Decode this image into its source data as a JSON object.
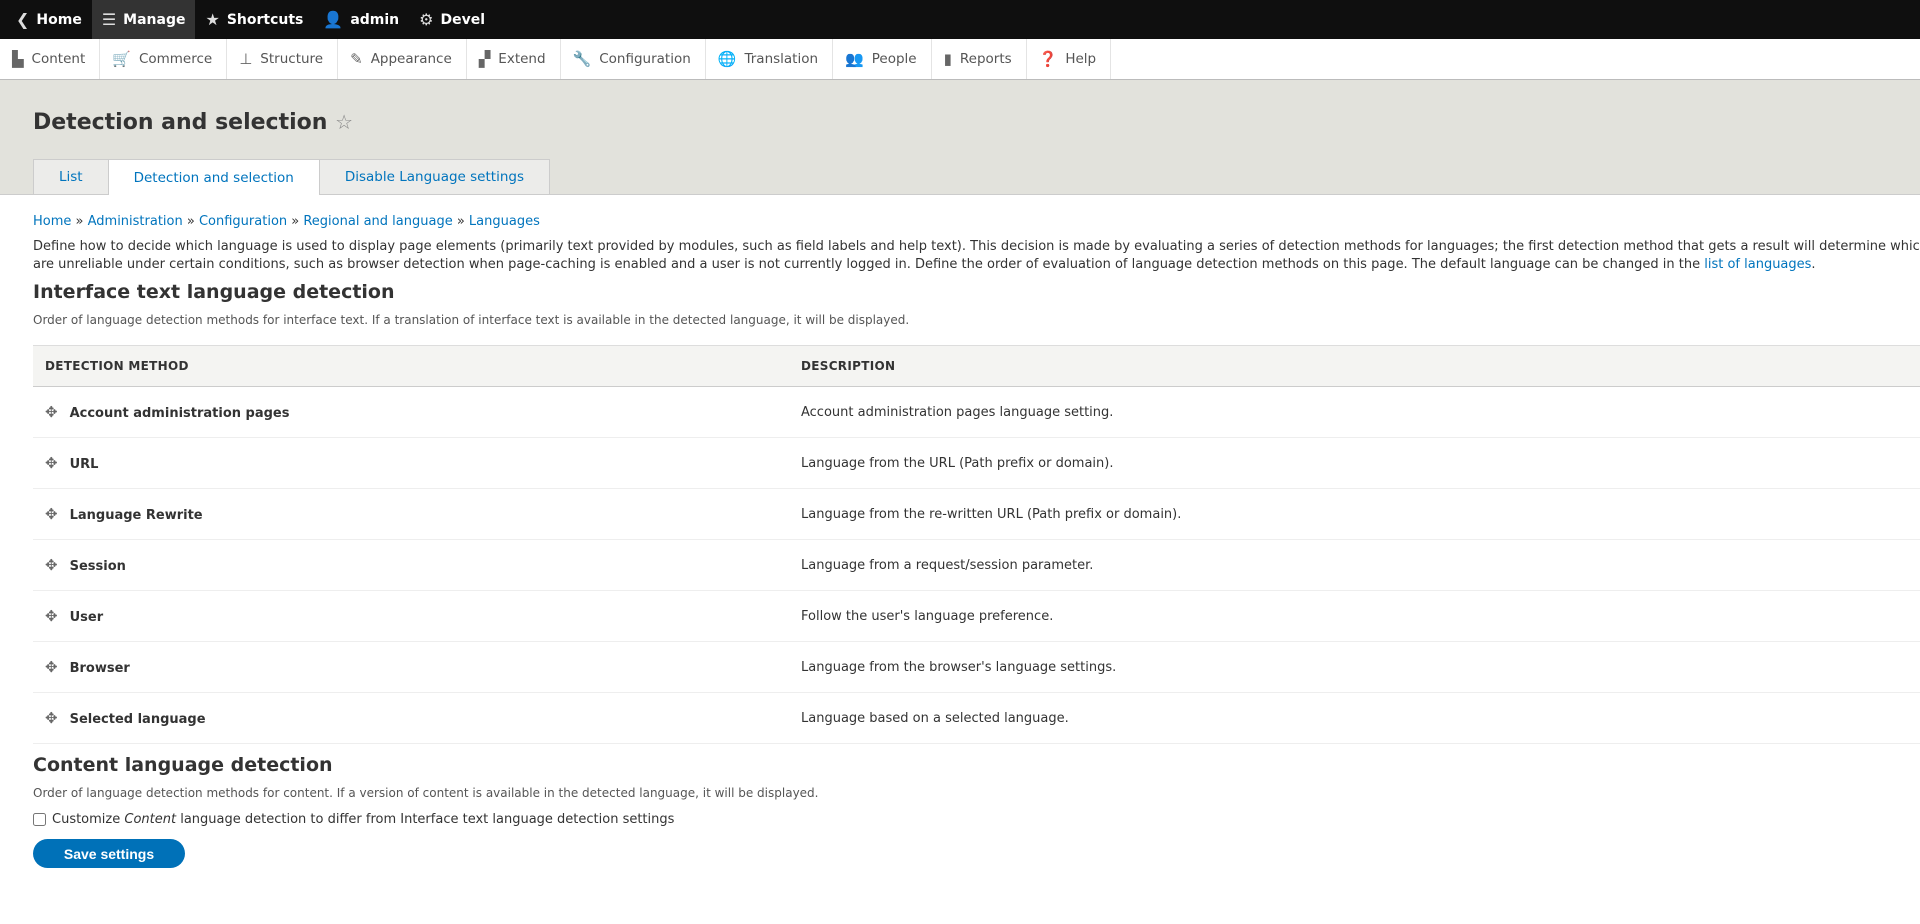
{
  "toolbar": {
    "items": [
      {
        "label": "Home",
        "icon": "chevron-left-circle-icon"
      },
      {
        "label": "Manage",
        "icon": "menu-icon"
      },
      {
        "label": "Shortcuts",
        "icon": "star-icon"
      },
      {
        "label": "admin",
        "icon": "user-icon"
      },
      {
        "label": "Devel",
        "icon": "gear-icon"
      }
    ]
  },
  "tray": {
    "items": [
      {
        "label": "Content",
        "icon": "file-icon"
      },
      {
        "label": "Commerce",
        "icon": "cart-icon"
      },
      {
        "label": "Structure",
        "icon": "sitemap-icon"
      },
      {
        "label": "Appearance",
        "icon": "brush-icon"
      },
      {
        "label": "Extend",
        "icon": "puzzle-icon"
      },
      {
        "label": "Configuration",
        "icon": "wrench-icon"
      },
      {
        "label": "Translation",
        "icon": "globe-icon"
      },
      {
        "label": "People",
        "icon": "people-icon"
      },
      {
        "label": "Reports",
        "icon": "bar-chart-icon"
      },
      {
        "label": "Help",
        "icon": "help-icon"
      }
    ]
  },
  "page": {
    "title": "Detection and selection",
    "tabs": [
      "List",
      "Detection and selection",
      "Disable Language settings"
    ]
  },
  "breadcrumb": [
    "Home",
    "Administration",
    "Configuration",
    "Regional and language",
    "Languages"
  ],
  "description": {
    "line1": "Define how to decide which language is used to display page elements (primarily text provided by modules, such as field labels and help text). This decision is made by evaluating a series of detection methods for languages; the first detection method that gets a result will determine which",
    "line2": "are unreliable under certain conditions, such as browser detection when page-caching is enabled and a user is not currently logged in. Define the order of evaluation of language detection methods on this page. The default language can be changed in the",
    "link": "list of languages",
    "end": "."
  },
  "interface": {
    "heading": "Interface text language detection",
    "desc": "Order of language detection methods for interface text. If a translation of interface text is available in the detected language, it will be displayed.",
    "columns": [
      "DETECTION METHOD",
      "DESCRIPTION"
    ],
    "rows": [
      [
        "Account administration pages",
        "Account administration pages language setting."
      ],
      [
        "URL",
        "Language from the URL (Path prefix or domain)."
      ],
      [
        "Language Rewrite",
        "Language from the re-written URL (Path prefix or domain)."
      ],
      [
        "Session",
        "Language from a request/session parameter."
      ],
      [
        "User",
        "Follow the user's language preference."
      ],
      [
        "Browser",
        "Language from the browser's language settings."
      ],
      [
        "Selected language",
        "Language based on a selected language."
      ]
    ]
  },
  "contentlang": {
    "heading": "Content language detection",
    "desc": "Order of language detection methods for content. If a version of content is available in the detected language, it will be displayed.",
    "checkbox_pre": "Customize ",
    "checkbox_em": "Content",
    "checkbox_post": " language detection to differ from Interface text language detection settings",
    "checked": false
  },
  "save_label": "Save settings"
}
